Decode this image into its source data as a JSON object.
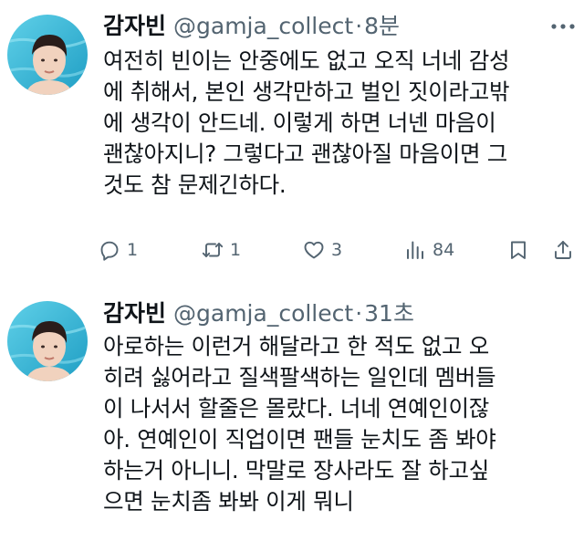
{
  "tweets": [
    {
      "display_name": "감자빈",
      "handle": "@gamja_collect",
      "separator": "·",
      "time": "8분",
      "lines": [
        "여전히 빈이는 안중에도 없고 오직 너네 감성",
        "에 취해서, 본인 생각만하고 벌인 짓이라고밖",
        "에 생각이 안드네. 이렇게 하면 너넨 마음이",
        "괜찮아지니? 그렇다고 괜찮아질 마음이면 그",
        "것도 참 문제긴하다."
      ],
      "replies": "1",
      "retweets": "1",
      "likes": "3",
      "views": "84"
    },
    {
      "display_name": "감자빈",
      "handle": "@gamja_collect",
      "separator": "·",
      "time": "31초",
      "lines": [
        "아로하는 이런거 해달라고 한 적도 없고 오",
        "히려 싫어라고 질색팔색하는 일인데 멤버들",
        "이 나서서 할줄은 몰랐다. 너네 연예인이잖",
        "아. 연예인이 직업이면 팬들 눈치도 좀 봐야",
        "하는거 아니니. 막말로 장사라도 잘 하고싶",
        "으면 눈치좀 봐봐 이게 뭐니"
      ]
    }
  ],
  "icons": {
    "more": "more-horizontal-icon",
    "reply": "reply-icon",
    "retweet": "retweet-icon",
    "like": "heart-icon",
    "views": "views-chart-icon",
    "bookmark": "bookmark-icon",
    "share": "share-icon"
  },
  "colors": {
    "text": "#0f1419",
    "secondary": "#536471",
    "avatar_background": "#2fb6d6"
  }
}
